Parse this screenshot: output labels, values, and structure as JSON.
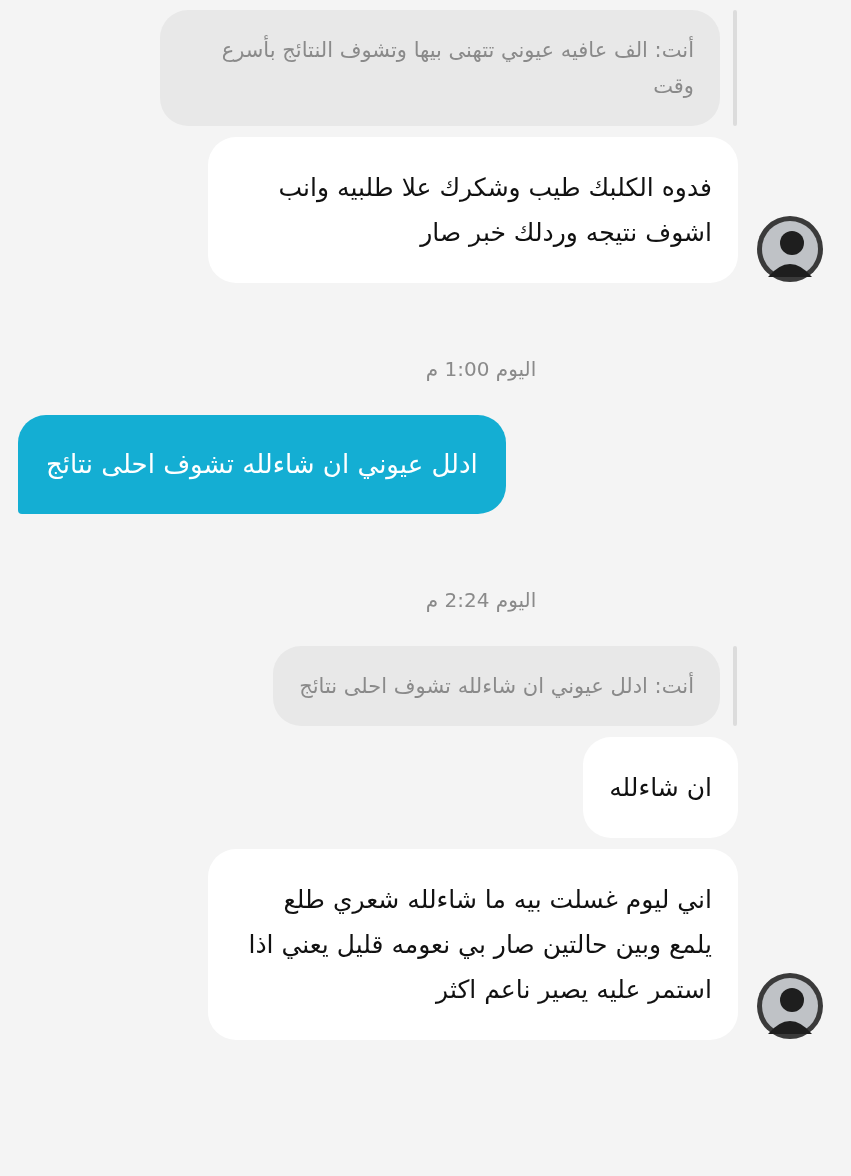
{
  "messages": [
    {
      "kind": "quote",
      "text": "أنت: الف عافيه عيوني تتهنى بيها وتشوف النتائج بأسرع وقت"
    },
    {
      "kind": "received",
      "text": "فدوه الكلبك طيب وشكرك علا طلبيه وانب اشوف نتيجه وردلك خبر صار",
      "avatar": true
    },
    {
      "kind": "time",
      "text": "اليوم 1:00 م"
    },
    {
      "kind": "sent",
      "text": "ادلل عيوني ان شاءلله تشوف احلى نتائج"
    },
    {
      "kind": "time",
      "text": "اليوم 2:24 م"
    },
    {
      "kind": "quote",
      "text": "أنت: ادلل عيوني ان شاءلله تشوف احلى نتائج"
    },
    {
      "kind": "received",
      "text": "ان شاءلله",
      "avatar": false
    },
    {
      "kind": "received",
      "text": "اني ليوم غسلت بيه ما شاءلله شعري طلع يلمع وبين حالتين صار بي نعومه قليل يعني اذا استمر عليه يصير ناعم اكثر",
      "avatar": true
    }
  ]
}
